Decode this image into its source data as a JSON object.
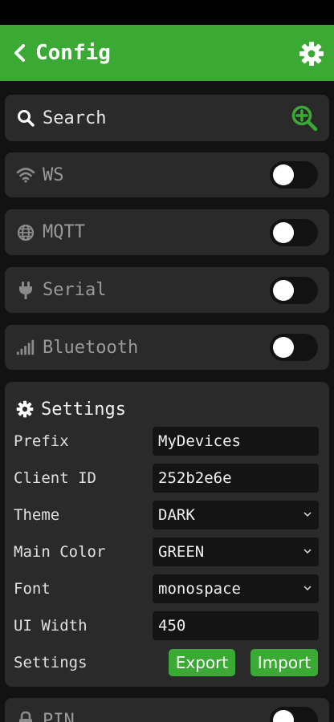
{
  "appbar": {
    "title": "Config"
  },
  "search": {
    "label": "Search"
  },
  "connections": [
    {
      "label": "WS",
      "icon": "wifi-icon",
      "enabled": false
    },
    {
      "label": "MQTT",
      "icon": "globe-icon",
      "enabled": false
    },
    {
      "label": "Serial",
      "icon": "plug-icon",
      "enabled": false
    },
    {
      "label": "Bluetooth",
      "icon": "signal-bars-icon",
      "enabled": false
    }
  ],
  "settings": {
    "title": "Settings",
    "rows": [
      {
        "key": "Prefix",
        "value": "MyDevices"
      },
      {
        "key": "Client ID",
        "value": "252b2e6e"
      },
      {
        "key": "Theme",
        "value": "DARK"
      },
      {
        "key": "Main Color",
        "value": "GREEN"
      },
      {
        "key": "Font",
        "value": "monospace"
      },
      {
        "key": "UI Width",
        "value": "450"
      }
    ],
    "actions_label": "Settings",
    "export_label": "Export",
    "import_label": "Import"
  },
  "pin": {
    "label": "PIN",
    "enabled": false
  },
  "colors": {
    "accent": "#3aaa35",
    "card": "#2a2a2a",
    "background": "#121212"
  }
}
